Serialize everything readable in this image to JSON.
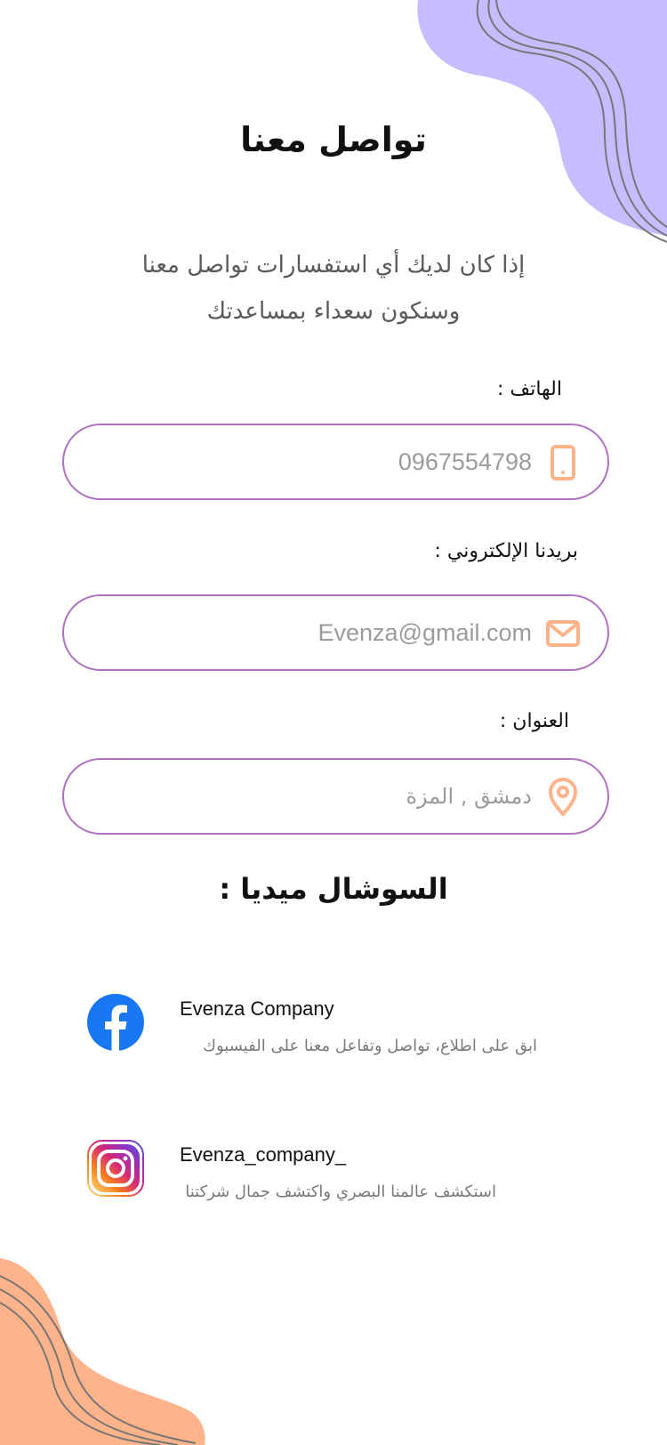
{
  "header": {
    "title": "تواصل معنا"
  },
  "intro": {
    "line1": "إذا كان لديك أي استفسارات تواصل معنا",
    "line2": "وسنكون سعداء بمساعدتك"
  },
  "fields": {
    "phone": {
      "label": "الهاتف :",
      "value": "0967554798",
      "icon": "phone-icon"
    },
    "email": {
      "label": "بريدنا الإلكتروني :",
      "value": "Evenza@gmail.com",
      "icon": "mail-icon"
    },
    "address": {
      "label": "العنوان :",
      "value": "دمشق , المزة",
      "icon": "location-pin-icon"
    }
  },
  "social": {
    "title": "السوشال ميديا :",
    "facebook": {
      "name": "Evenza Company",
      "desc": "ابق على اطلاع، تواصل  وتفاعل معنا على الفيسبوك",
      "icon": "facebook-icon"
    },
    "instagram": {
      "name": "Evenza_company_",
      "desc": "استكشف عالمنا البصري واكتشف جمال شركتنا",
      "icon": "instagram-icon"
    }
  },
  "colors": {
    "accent_border": "#b071c0",
    "icon_orange": "#ffb38a",
    "blob_purple": "#c6bcff",
    "blob_orange": "#ffb38a"
  }
}
